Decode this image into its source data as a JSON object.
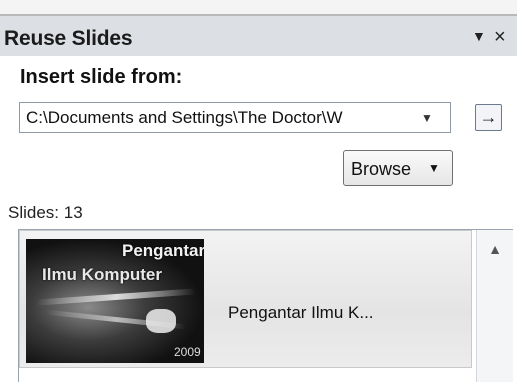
{
  "pane": {
    "title": "Reuse Slides",
    "menu_icon": "▼",
    "close_icon": "×"
  },
  "insert": {
    "label": "Insert slide from:",
    "path_value": "C:\\Documents and Settings\\The Doctor\\W",
    "dropdown_icon": "▼",
    "go_icon": "→"
  },
  "browse": {
    "label": "Browse",
    "caret": "▼"
  },
  "slides": {
    "count_label": "Slides: 13",
    "items": [
      {
        "thumb_title_line1": "Pengantar",
        "thumb_title_line2": "Ilmu Komputer",
        "thumb_number": "2009",
        "caption": "Pengantar  Ilmu K..."
      }
    ]
  },
  "scrollbar": {
    "up_icon": "▲"
  }
}
